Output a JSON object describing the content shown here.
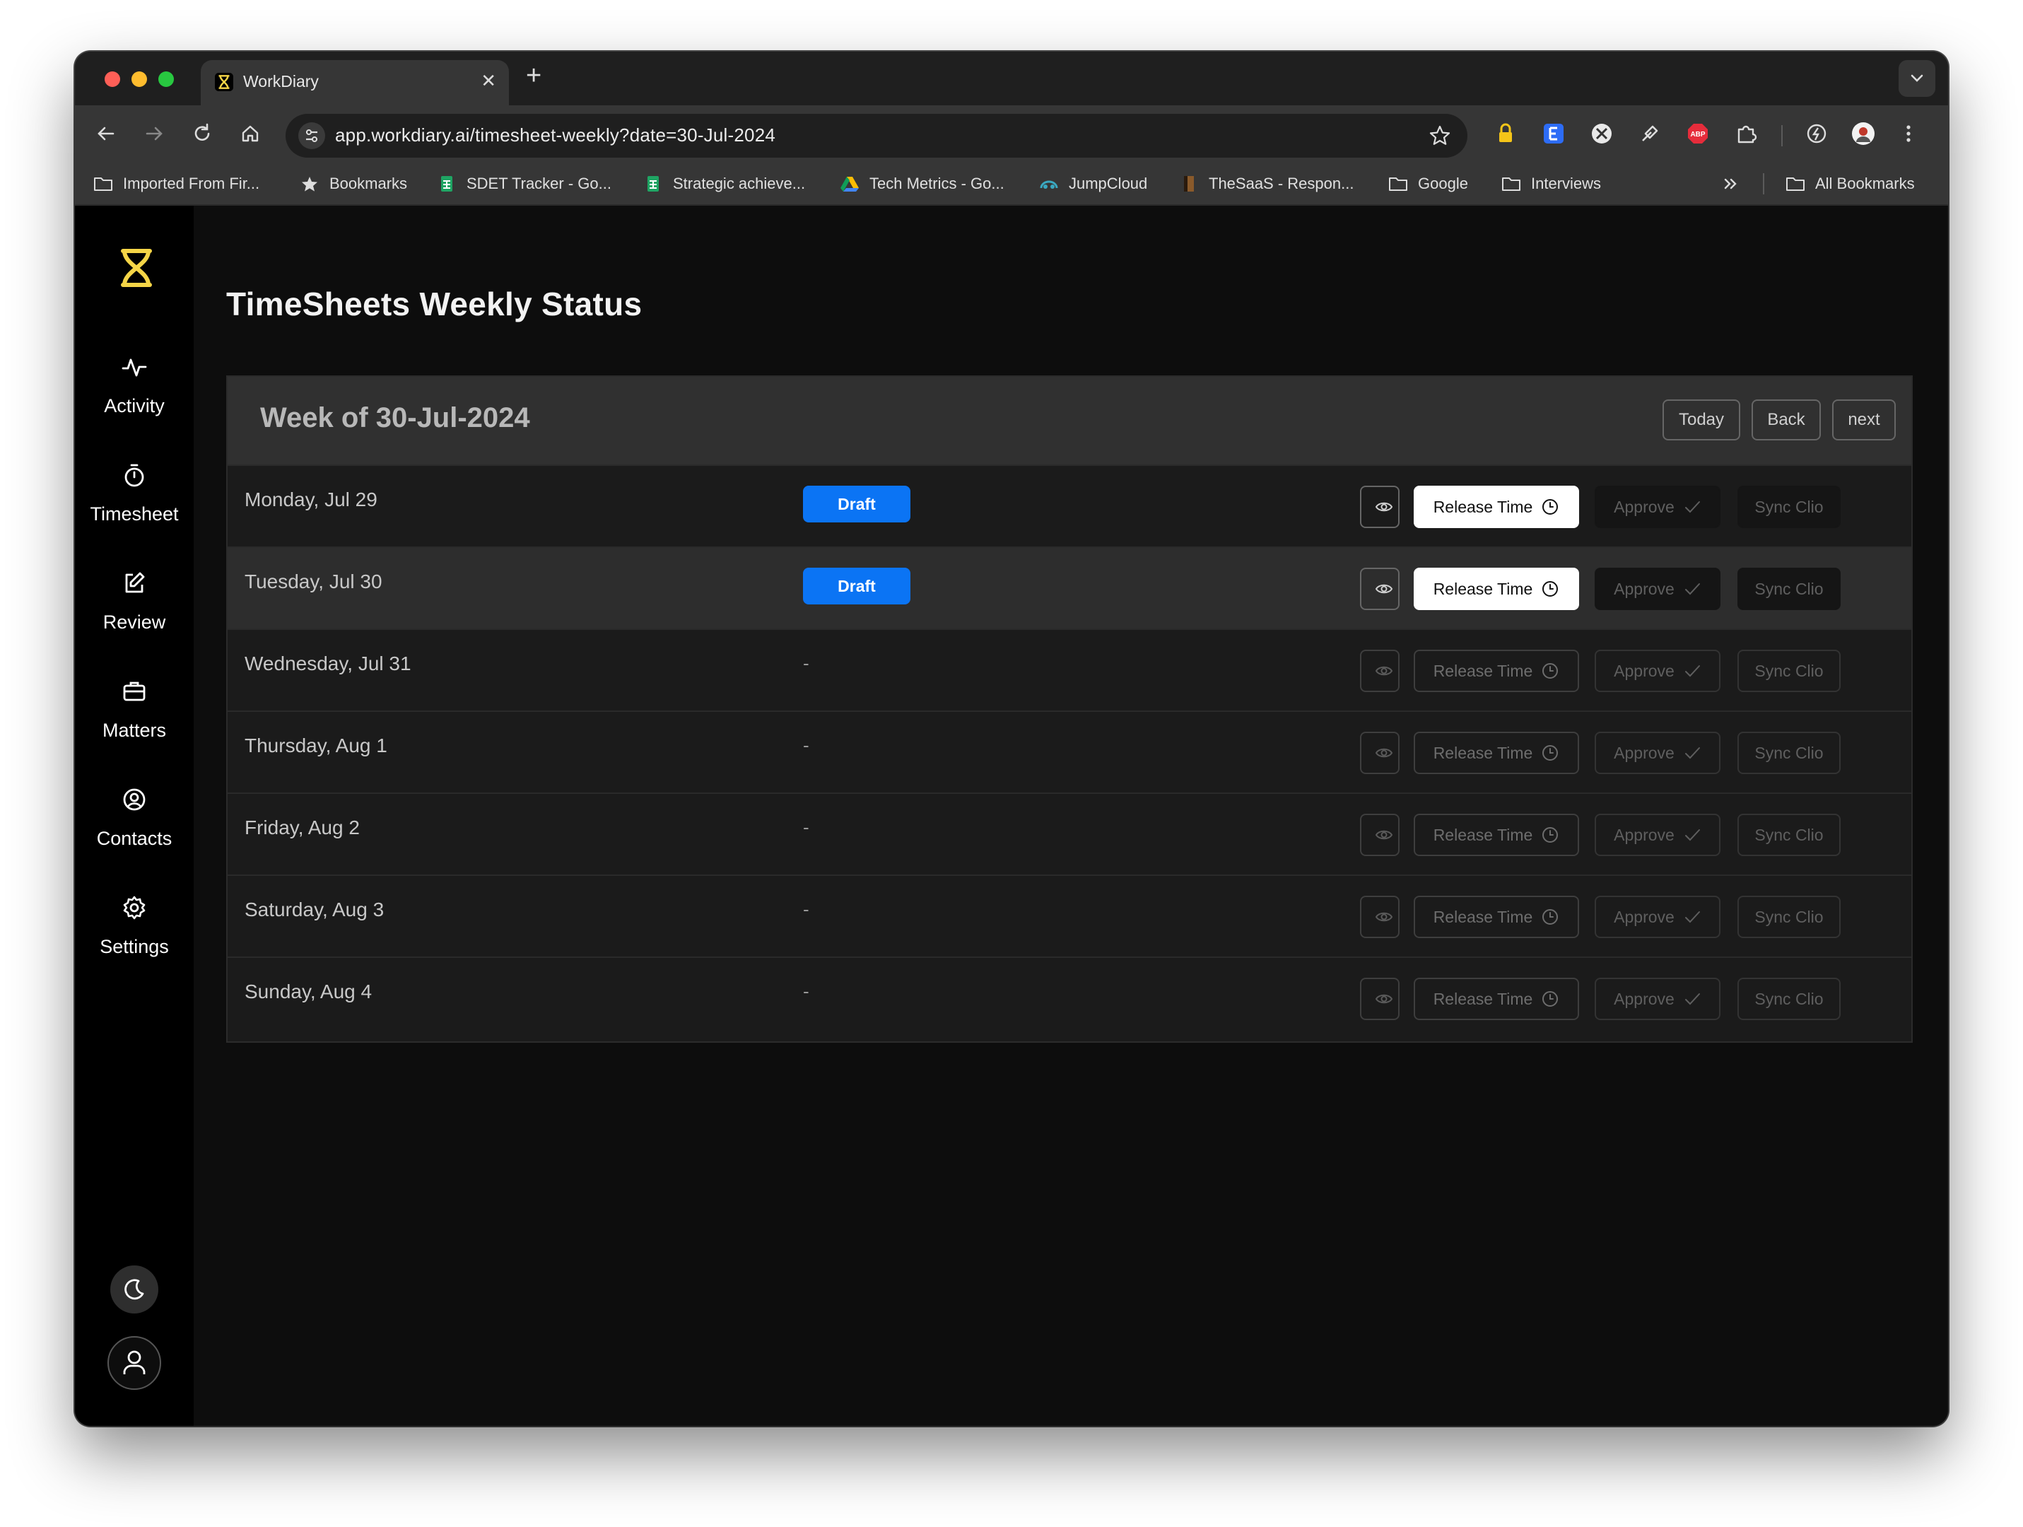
{
  "browser": {
    "tab_title": "WorkDiary",
    "url": "app.workdiary.ai/timesheet-weekly?date=30-Jul-2024",
    "bookmarks": [
      {
        "label": "Imported From Fir...",
        "icon": "folder-icon"
      },
      {
        "label": "Bookmarks",
        "icon": "star-icon"
      },
      {
        "label": "SDET Tracker - Go...",
        "icon": "sheets-icon"
      },
      {
        "label": "Strategic achieve...",
        "icon": "sheets-icon"
      },
      {
        "label": "Tech Metrics - Go...",
        "icon": "drive-icon"
      },
      {
        "label": "JumpCloud",
        "icon": "jumpcloud-icon"
      },
      {
        "label": "TheSaaS - Respon...",
        "icon": "site-icon"
      },
      {
        "label": "Google",
        "icon": "folder-icon"
      },
      {
        "label": "Interviews",
        "icon": "folder-icon"
      }
    ],
    "all_bookmarks": "All Bookmarks"
  },
  "sidebar": {
    "items": [
      {
        "label": "Activity",
        "icon": "activity-icon"
      },
      {
        "label": "Timesheet",
        "icon": "stopwatch-icon"
      },
      {
        "label": "Review",
        "icon": "edit-icon"
      },
      {
        "label": "Matters",
        "icon": "briefcase-icon"
      },
      {
        "label": "Contacts",
        "icon": "user-circle-icon"
      },
      {
        "label": "Settings",
        "icon": "gear-icon"
      }
    ]
  },
  "page": {
    "title": "TimeSheets Weekly Status",
    "week_title": "Week of 30-Jul-2024",
    "buttons": {
      "today": "Today",
      "back": "Back",
      "next": "next"
    },
    "row_actions": {
      "release": "Release Time",
      "approve": "Approve",
      "sync": "Sync Clio"
    },
    "rows": [
      {
        "day": "Monday, Jul 29",
        "status": "Draft"
      },
      {
        "day": "Tuesday, Jul 30",
        "status": "Draft"
      },
      {
        "day": "Wednesday, Jul 31",
        "status": "-"
      },
      {
        "day": "Thursday, Aug 1",
        "status": "-"
      },
      {
        "day": "Friday, Aug 2",
        "status": "-"
      },
      {
        "day": "Saturday, Aug 3",
        "status": "-"
      },
      {
        "day": "Sunday, Aug 4",
        "status": "-"
      }
    ]
  },
  "colors": {
    "draft_badge": "#0b74f4",
    "logo": "#f5d547",
    "app_background": "#0d0d0d"
  }
}
